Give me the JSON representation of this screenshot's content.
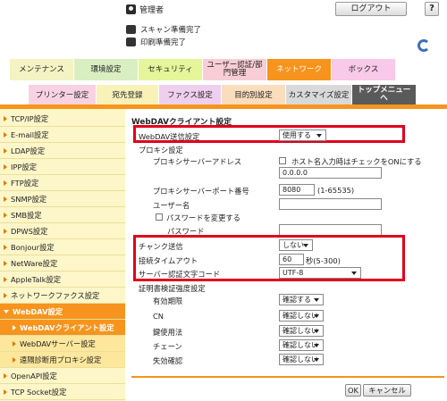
{
  "header": {
    "user_label": "管理者",
    "logout_label": "ログアウト",
    "help_label": "?",
    "status": [
      {
        "text": "スキャン準備完了"
      },
      {
        "text": "印刷準備完了"
      }
    ]
  },
  "tabs_primary": [
    {
      "label": "メンテナンス",
      "color": "#f3f3c4"
    },
    {
      "label": "環境設定",
      "color": "#d9efc2"
    },
    {
      "label": "セキュリティ",
      "color": "#e4f59a"
    },
    {
      "label": "ユーザー認証/部門管理",
      "color": "#f9cdd6"
    },
    {
      "label": "ネットワーク",
      "color": "#f6941d"
    },
    {
      "label": "ボックス",
      "color": "#f8c9e8"
    }
  ],
  "tabs_secondary": [
    {
      "label": "プリンター設定",
      "color": "#f8d2e3"
    },
    {
      "label": "宛先登録",
      "color": "#f9f2b8"
    },
    {
      "label": "ファクス設定",
      "color": "#efcfee"
    },
    {
      "label": "目的別設定",
      "color": "#f9ddbd"
    },
    {
      "label": "カスタマイズ設定",
      "color": "#d9d9d9"
    },
    {
      "label": "トップメニューへ",
      "color": "#5a5a5a"
    }
  ],
  "sidebar": {
    "items": [
      {
        "label": "TCP/IP設定",
        "type": "top"
      },
      {
        "label": "E-mail設定",
        "type": "top"
      },
      {
        "label": "LDAP設定",
        "type": "top"
      },
      {
        "label": "IPP設定",
        "type": "top"
      },
      {
        "label": "FTP設定",
        "type": "top"
      },
      {
        "label": "SNMP設定",
        "type": "top"
      },
      {
        "label": "SMB設定",
        "type": "top"
      },
      {
        "label": "DPWS設定",
        "type": "top"
      },
      {
        "label": "Bonjour設定",
        "type": "top"
      },
      {
        "label": "NetWare設定",
        "type": "top"
      },
      {
        "label": "AppleTalk設定",
        "type": "top"
      },
      {
        "label": "ネットワークファクス設定",
        "type": "top"
      },
      {
        "label": "WebDAV設定",
        "type": "active"
      },
      {
        "label": "WebDAVクライアント設定",
        "type": "current"
      },
      {
        "label": "WebDAVサーバー設定",
        "type": "sub"
      },
      {
        "label": "遠隔診断用プロキシ設定",
        "type": "sub"
      },
      {
        "label": "OpenAPI設定",
        "type": "top"
      },
      {
        "label": "TCP Socket設定",
        "type": "top"
      }
    ]
  },
  "main": {
    "page_title": "WebDAVクライアント設定",
    "webdav_send_label": "WebDAV送信設定",
    "webdav_send_value": "使用する",
    "proxy_section": "プロキシ設定",
    "proxy_address_label": "プロキシサーバーアドレス",
    "host_checkbox_label": "ホスト名入力時はチェックをONにする",
    "proxy_address_value": "0.0.0.0",
    "proxy_port_label": "プロキシサーバーポート番号",
    "proxy_port_value": "8080",
    "proxy_port_range": "(1-65535)",
    "username_label": "ユーザー名",
    "username_value": "",
    "change_password_label": "パスワードを変更する",
    "password_label": "パスワード",
    "password_value": "",
    "chunk_label": "チャンク送信",
    "chunk_value": "しない",
    "timeout_label": "接続タイムアウト",
    "timeout_value": "60",
    "timeout_unit": "秒(5-300)",
    "charset_label": "サーバー認証文字コード",
    "charset_value": "UTF-8",
    "cert_section": "証明書検証強度設定",
    "cert_rows": [
      {
        "label": "有効期限",
        "value": "確認する"
      },
      {
        "label": "CN",
        "value": "確認しない"
      },
      {
        "label": "鍵使用法",
        "value": "確認しない"
      },
      {
        "label": "チェーン",
        "value": "確認しない"
      },
      {
        "label": "失効確認",
        "value": "確認しない"
      }
    ],
    "ok_label": "OK",
    "cancel_label": "キャンセル"
  }
}
